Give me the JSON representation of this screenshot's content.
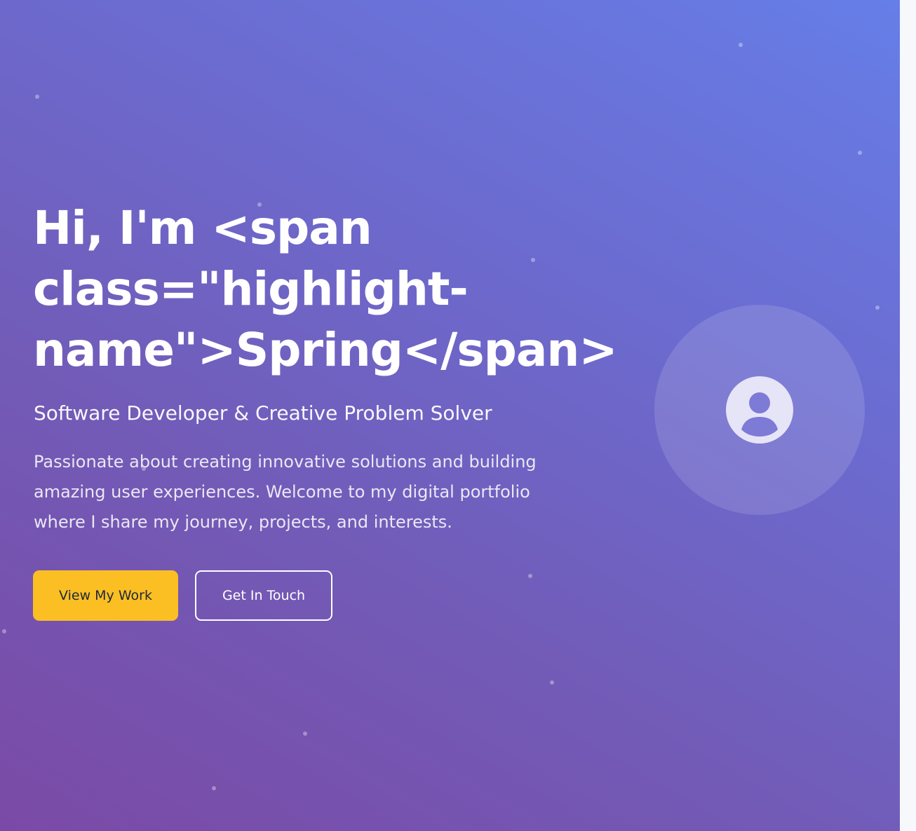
{
  "hero": {
    "title": "Hi, I'm <span\nclass=\"highlight-\nname\">Spring</span>",
    "subtitle": "Software Developer & Creative Problem Solver",
    "description": "Passionate about creating innovative solutions and building amazing user experiences. Welcome to my digital portfolio where I share my journey, projects, and interests."
  },
  "buttons": {
    "primary_label": "View My Work",
    "secondary_label": "Get In Touch"
  },
  "colors": {
    "accent": "#fbbf24",
    "gradient_start": "#7a4aa6",
    "gradient_end": "#667ee8"
  },
  "icons": {
    "avatar": "user-circle-icon"
  }
}
